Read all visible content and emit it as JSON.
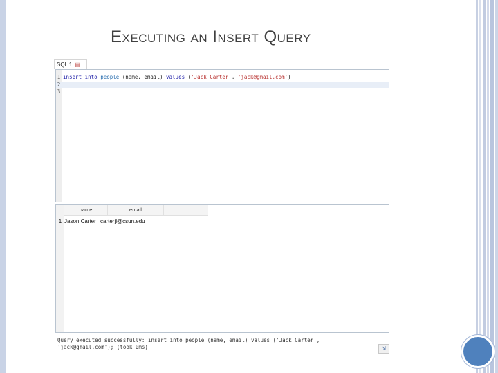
{
  "slide": {
    "title": "Executing an Insert Query"
  },
  "editor_tab": {
    "label": "SQL 1",
    "close_icon": "close-icon"
  },
  "editor": {
    "lines": [
      {
        "number": "1",
        "tokens": {
          "kw1": "insert into",
          "table": "people",
          "cols": "(name, email)",
          "kw2": "values",
          "open": "(",
          "val1": "'Jack Carter'",
          "sep": ", ",
          "val2": "'jack@gmail.com'",
          "close": ")"
        }
      },
      {
        "number": "2",
        "text": ""
      },
      {
        "number": "3",
        "text": ""
      }
    ]
  },
  "results": {
    "columns": [
      "name",
      "email"
    ],
    "rows": [
      {
        "num": "1",
        "name": "Jason Carter",
        "email": "carterjl@csun.edu"
      }
    ]
  },
  "status": {
    "message": "Query executed successfully: insert into people (name, email) values ('Jack Carter',\n'jack@gmail.com'); (took 0ms)",
    "button_icon": "export-icon"
  },
  "colors": {
    "keyword": "#1a1aa6",
    "identifier": "#2b6fb0",
    "string": "#b8312f",
    "accent": "#4f81bd"
  }
}
